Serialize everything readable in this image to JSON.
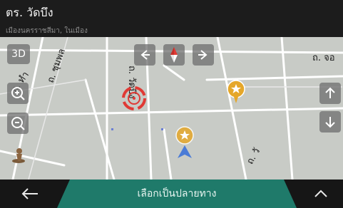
{
  "header": {
    "title": "ตร. วัดบึง",
    "subtitle": "เมืองนครราชสีมา, ในเมือง"
  },
  "map": {
    "mode_button_label": "3D",
    "road_labels": {
      "top_right": "ถ. จอ",
      "left_diag": "ถ. ชุมพล",
      "center_vertical": "ถ. วัดบึง",
      "left_edge": "ถ. ทำ",
      "bottom_center": "ถ. วั"
    }
  },
  "bottom": {
    "select_destination_label": "เลือกเป็นปลายทาง"
  },
  "colors": {
    "header_bg": "#1c1c1c",
    "map_bg": "#c8cbc6",
    "road": "#ffffff",
    "accent_green": "#1f7a6a",
    "cursor_red": "#e03a35",
    "pin_gold": "#e5a72a"
  }
}
